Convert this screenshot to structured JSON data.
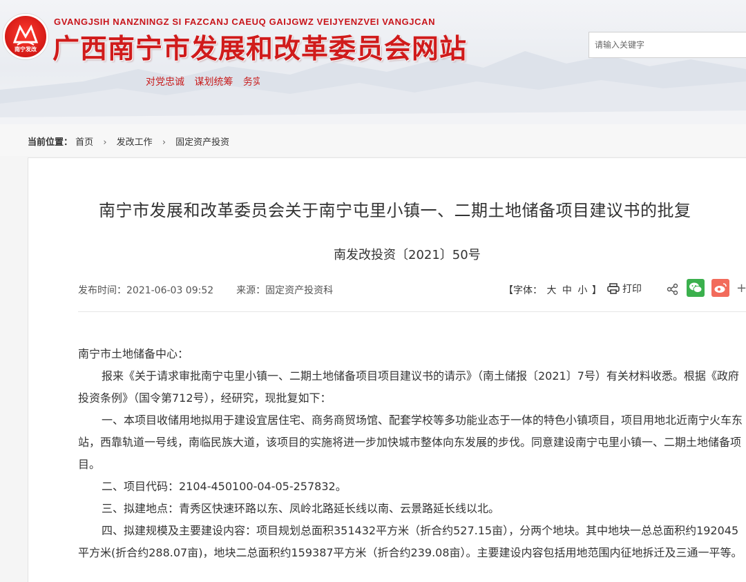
{
  "header": {
    "logo_text": "南宁发改",
    "site_name_en": "GVANGJSIH NANZNINGZ SI FAZCANJ CAEUQ GAIJGWZ VEIJYENZVEI VANGJCAN",
    "site_name": "广西南宁市发展和改革委员会网站",
    "slogans": [
      "对党忠诚",
      "谋划统筹",
      "务实"
    ],
    "search_placeholder": "请输入关键字"
  },
  "breadcrumb": {
    "label": "当前位置：",
    "items": [
      "首页",
      "发改工作",
      "固定资产投资"
    ]
  },
  "article": {
    "title": "南宁市发展和改革委员会关于南宁屯里小镇一、二期土地储备项目建议书的批复",
    "doc_no": "南发改投资〔2021〕50号",
    "publish_label": "发布时间：",
    "publish_time": "2021-06-03 09:52",
    "source_label": "来源：",
    "source": "固定资产投资科",
    "font_label": "【字体：",
    "font_large": "大",
    "font_medium": "中",
    "font_small": "小",
    "font_end": "】",
    "print_label": "打印",
    "more_label": "+",
    "paragraphs": [
      "南宁市土地储备中心：",
      "报来《关于请求审批南宁屯里小镇一、二期土地储备项目项目建议书的请示》（南土储报〔2021〕7号）有关材料收悉。根据《政府投资条例》（国令第712号），经研究，现批复如下：",
      "一、本项目收储用地拟用于建设宜居住宅、商务商贸场馆、配套学校等多功能业态于一体的特色小镇项目，项目用地北近南宁火车东站，西靠轨道一号线，南临民族大道，该项目的实施将进一步加快城市整体向东发展的步伐。同意建设南宁屯里小镇一、二期土地储备项目。",
      "二、项目代码：2104-450100-04-05-257832。",
      "三、拟建地点：青秀区快速环路以东、凤岭北路延长线以南、云景路延长线以北。",
      "四、拟建规模及主要建设内容：项目规划总面积351432平方米（折合约527.15亩），分两个地块。其中地块一总总面积约192045平方米(折合约288.07亩)，地块二总面积约159387平方米（折合约239.08亩）。主要建设内容包括用地范围内征地拆迁及三通一平等。"
    ]
  }
}
